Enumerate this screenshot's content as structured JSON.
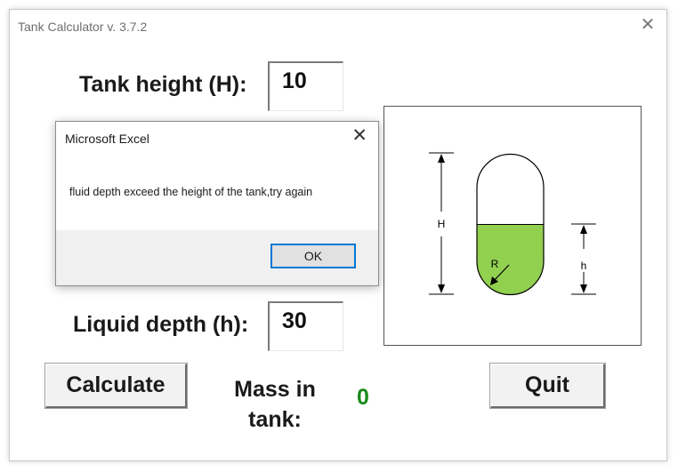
{
  "window": {
    "title": "Tank Calculator v. 3.7.2",
    "close_glyph": "✕"
  },
  "form": {
    "tank_height_label": "Tank height (H):",
    "tank_height_value": "10",
    "liquid_depth_label": "Liquid depth (h):",
    "liquid_depth_value": "30",
    "calculate_label": "Calculate",
    "quit_label": "Quit",
    "mass_label_line1": "Mass in",
    "mass_label_line2": "tank:",
    "mass_value": "0"
  },
  "diagram": {
    "H_label": "H",
    "h_label": "h",
    "R_label": "R",
    "fill_color": "#92d050",
    "fill_level": 0.5
  },
  "dialog": {
    "title": "Microsoft Excel",
    "close_glyph": "✕",
    "message": "fluid depth exceed the height of the tank,try again",
    "ok_label": "OK",
    "accent": "#0078d7"
  }
}
